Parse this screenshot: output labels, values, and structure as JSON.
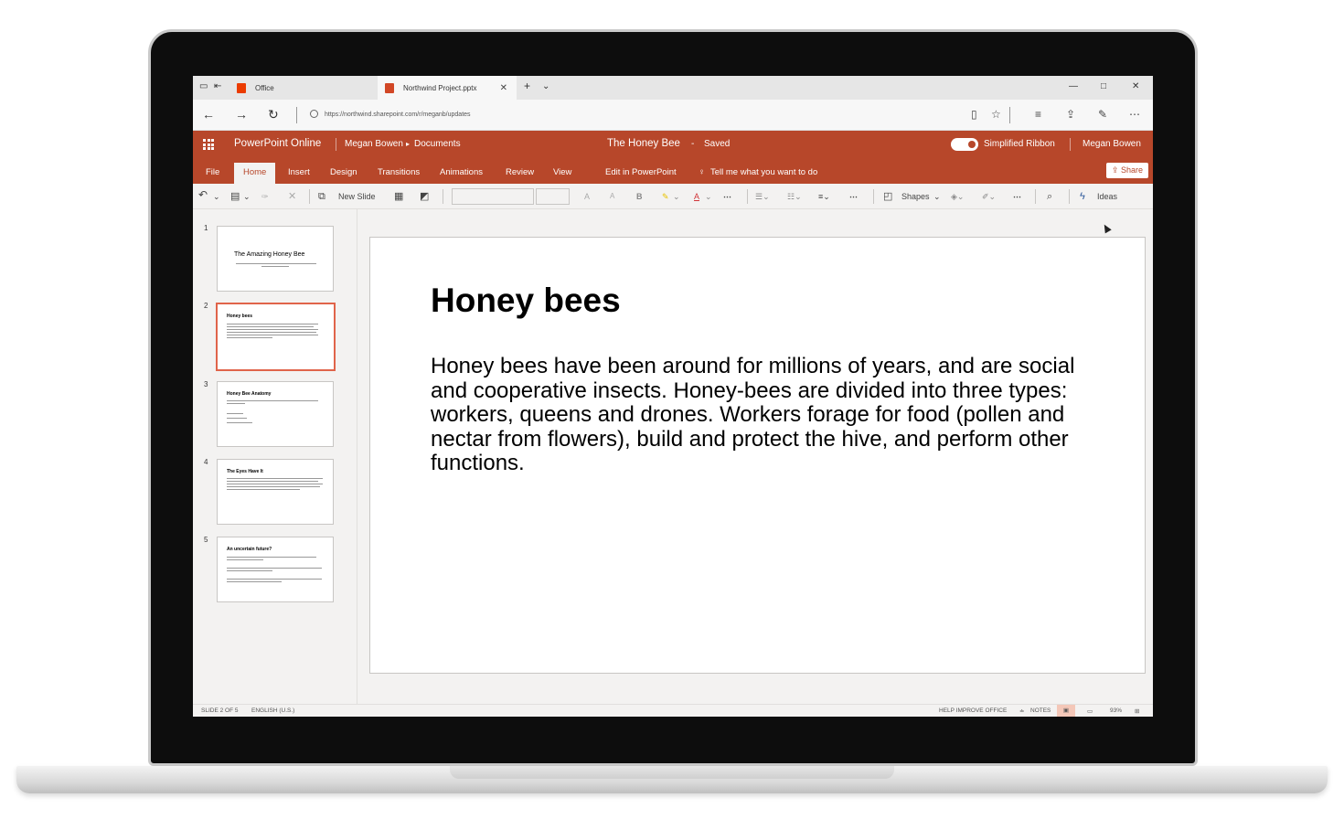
{
  "browser": {
    "tabs": [
      {
        "label": "Office",
        "favicon_color": "#eb3c00"
      },
      {
        "label": "Northwind Project.pptx",
        "favicon_color": "#d24726"
      }
    ],
    "new_tab": "+",
    "url": "https://northwind.sharepoint.com/r/meganb/updates"
  },
  "app": {
    "name": "PowerPoint Online",
    "breadcrumb_user": "Megan Bowen",
    "breadcrumb_sep": "▸",
    "breadcrumb_folder": "Documents",
    "doc_title": "The Honey Bee",
    "doc_status_sep": "-",
    "doc_status": "Saved",
    "ribbon_toggle_label": "Simplified Ribbon",
    "user": "Megan Bowen",
    "accent": "#b7472a"
  },
  "ribbon": {
    "tabs": [
      "File",
      "Home",
      "Insert",
      "Design",
      "Transitions",
      "Animations",
      "Review",
      "View"
    ],
    "active_tab": "Home",
    "edit_in_app": "Edit in PowerPoint",
    "tell_me": "Tell me what you want to do",
    "share": "Share"
  },
  "toolbar": {
    "new_slide": "New Slide",
    "shapes": "Shapes",
    "ideas": "Ideas",
    "bold": "B",
    "font_grow": "A",
    "font_shrink": "A",
    "font_color": "A",
    "more": "⋯"
  },
  "thumbnails": [
    {
      "num": "1",
      "title": "The Amazing Honey Bee"
    },
    {
      "num": "2",
      "title": "Honey bees"
    },
    {
      "num": "3",
      "title": "Honey Bee Anatomy"
    },
    {
      "num": "4",
      "title": "The Eyes Have It"
    },
    {
      "num": "5",
      "title": "An uncertain future?"
    }
  ],
  "slide": {
    "title": "Honey bees",
    "body": "Honey bees have been around for millions of years, and are social and cooperative insects. Honey-bees are divided into three types: workers, queens and drones. Workers forage for food (pollen and nectar from flowers), build and protect the hive, and perform other functions."
  },
  "status": {
    "slide_info": "SLIDE 2 OF 5",
    "language": "ENGLISH (U.S.)",
    "help": "HELP IMPROVE OFFICE",
    "notes": "NOTES",
    "zoom": "93%"
  }
}
